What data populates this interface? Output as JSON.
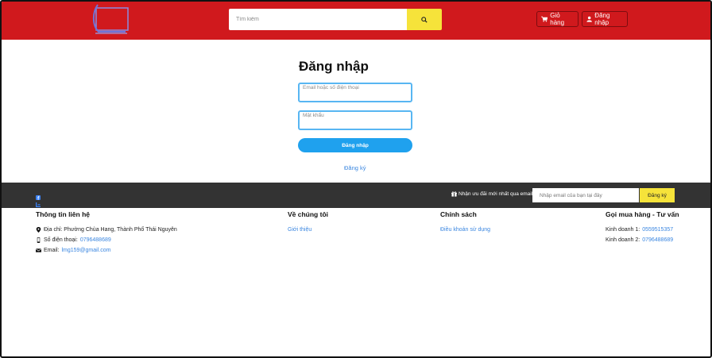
{
  "header": {
    "search_placeholder": "Tìm kiếm",
    "cart_label": "Giỏ hàng",
    "login_label": "Đăng nhập",
    "colors": {
      "brand_red": "#d0191d",
      "accent_yellow": "#f6e33a"
    }
  },
  "login": {
    "title": "Đăng nhập",
    "email_placeholder": "Email hoặc số điện thoại",
    "password_placeholder": "Mật khẩu",
    "submit_label": "Đăng nhập",
    "register_link": "Đăng ký"
  },
  "newsletter": {
    "label": "Nhận ưu đãi mới nhất qua email",
    "placeholder": "Nhập email của bạn tại đây",
    "button_label": "Đăng ký"
  },
  "footer": {
    "contact": {
      "heading": "Thông tin liên hệ",
      "address_label": "Địa chỉ: Phường Chùa Hang, Thành Phố Thái Nguyên",
      "phone_label": "Số điện thoại:",
      "phone_value": "0796488689",
      "email_label": "Email:",
      "email_value": "lmg159@gmail.com"
    },
    "about": {
      "heading": "Về chúng tôi",
      "link": "Giới thiệu"
    },
    "policy": {
      "heading": "Chính sách",
      "link": "Điều khoản sử dụng"
    },
    "hotline": {
      "heading": "Gọi mua hàng - Tư vấn",
      "sales1_label": "Kinh doanh 1:",
      "sales1_value": "0559515357",
      "sales2_label": "Kinh doanh 2:",
      "sales2_value": "0796488689"
    }
  }
}
